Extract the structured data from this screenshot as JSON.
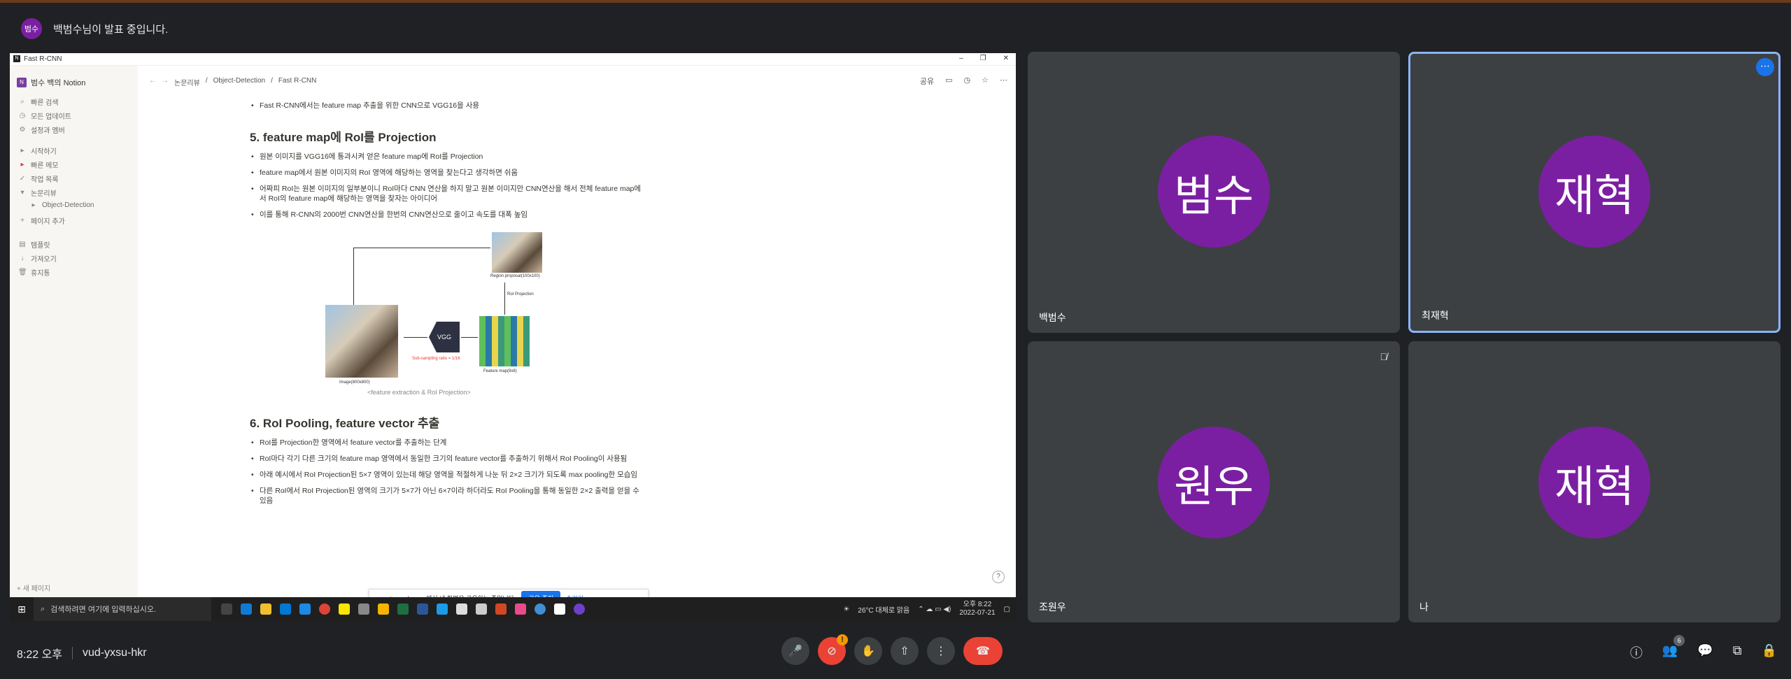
{
  "presenter": {
    "avatar_text": "범수",
    "message": "백범수님이 발표 중입니다."
  },
  "shared_window": {
    "title": "Fast R-CNN",
    "controls": [
      "–",
      "❐",
      "✕"
    ],
    "workspace": "범수 백의 Notion",
    "sidebar_top": [
      {
        "label": "빠른 검색",
        "icon": "search"
      },
      {
        "label": "모든 업데이트",
        "icon": "clock"
      },
      {
        "label": "설정과 멤버",
        "icon": "gear"
      }
    ],
    "sidebar_pages": [
      {
        "label": "시작하기",
        "icon": "page"
      },
      {
        "label": "빠른 메모",
        "icon": "pin"
      },
      {
        "label": "작업 목록",
        "icon": "check"
      },
      {
        "label": "논문리뷰",
        "icon": "page"
      },
      {
        "label": "Object-Detection",
        "icon": "page"
      },
      {
        "label": "페이지 추가",
        "icon": "plus"
      }
    ],
    "sidebar_tools": [
      {
        "label": "템플릿",
        "icon": "template"
      },
      {
        "label": "가져오기",
        "icon": "download"
      },
      {
        "label": "휴지통",
        "icon": "trash"
      }
    ],
    "new_page": "새 페이지",
    "breadcrumbs": [
      "논문리뷰",
      "Object-Detection",
      "Fast R-CNN"
    ],
    "share_label": "공유",
    "intro_bullet": "Fast R-CNN에서는 feature map 추출을 위한 CNN으로 VGG16을 사용",
    "section5": {
      "heading": "5. feature map에 RoI를 Projection",
      "bullets": [
        "원본 이미지를 VGG16에 통과시켜 얻은 feature map에 RoI를 Projection",
        "feature map에서 원본 이미지의 RoI 영역에 해당하는 영역을 찾는다고 생각하면 쉬움",
        "어짜피 RoI는 원본 이미지의 일부분이니 RoI마다 CNN 연산을 하지 말고 원본 이미지만 CNN연산을 해서 전체 feature map에서 RoI의 feature map에 해당하는 영역을 찾자는 아이디어",
        "이를 통해 R-CNN의 2000번 CNN연산을 한번의 CNN연산으로 줄이고 속도를 대폭 높임"
      ]
    },
    "figure": {
      "region_label": "Region proposal(100x100)",
      "roi_label": "RoI Projection",
      "image_label": "Image(800x800)",
      "vgg_label": "VGG",
      "subsample_label": "Sub-sampling ratio = 1/16",
      "fmap_label": "Feature map(8x8)",
      "caption": "<feature extraction & RoI Projection>"
    },
    "section6": {
      "heading": "6. RoI Pooling, feature vector 추출",
      "bullets": [
        "RoI를 Projection한 영역에서 feature vector를 추출하는 단계",
        "RoI마다 각기 다른 크기의 feature map 영역에서 동일한 크기의 feature vector를 추출하기 위해서 RoI Pooling이 사용됨",
        "아래 예시에서 RoI Projection된 5×7 영역이 있는데 해당 영역을 적절하게 나눈 뒤 2×2 크기가 되도록 max pooling한 모습임",
        "다른 RoI에서 RoI Projection된 영역의 크기가 5×7가 아닌 6×7이라 하더라도 RoI Pooling을 통해 동일한 2×2 출력을 얻을 수 있음"
      ]
    },
    "share_notice": {
      "text": "meet.google.com에서 내 화면을 공유하는 중입니다.",
      "stop": "공유 중지",
      "hide": "숨기기"
    },
    "help": "?",
    "taskbar": {
      "search_placeholder": "검색하려면 여기에 입력하십시오.",
      "weather": "26°C 대체로 맑음",
      "time": "오후 8:22",
      "date": "2022-07-21"
    }
  },
  "participants": [
    {
      "avatar": "범수",
      "name": "백범수",
      "active": false,
      "muted": false
    },
    {
      "avatar": "재혁",
      "name": "최재혁",
      "active": true,
      "muted": false
    },
    {
      "avatar": "원우",
      "name": "조원우",
      "active": false,
      "muted": true
    },
    {
      "avatar": "재혁",
      "name": "나",
      "active": false,
      "muted": false
    }
  ],
  "bottom": {
    "time": "8:22 오후",
    "meeting_code": "vud-yxsu-hkr",
    "people_count": "6",
    "warning_badge": "!"
  },
  "colors": {
    "avatar_purple": "#7b1fa2",
    "meet_bg": "#202124",
    "tile_bg": "#3c4043",
    "active_border": "#8ab4f8",
    "hangup_red": "#ea4335"
  }
}
